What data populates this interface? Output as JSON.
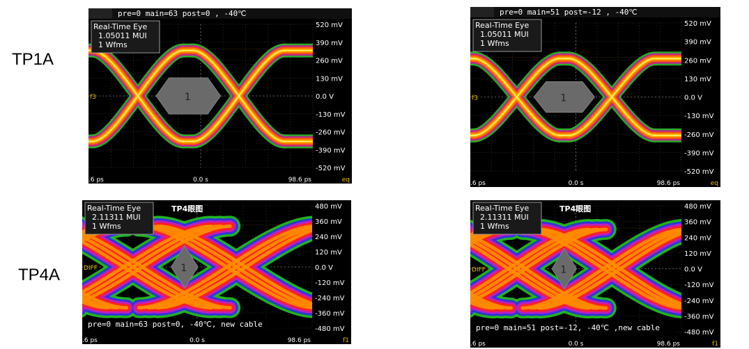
{
  "rows": [
    {
      "label": "TP1A"
    },
    {
      "label": "TP4A"
    }
  ],
  "chart_data": [
    {
      "type": "eye-diagram",
      "row_label": "TP1A",
      "header": "pre=0 main=63 post=0 , -40℃",
      "footer": "",
      "overlay_title": "",
      "info_box": [
        "Real-Time Eye",
        "1.05011 MUI",
        "1 Wfms"
      ],
      "channel_label": "f3",
      "corner_label": "eq",
      "y_ticks": [
        "520 mV",
        "390 mV",
        "260 mV",
        "130 mV",
        "0.0 V",
        "-130 mV",
        "-260 mV",
        "-390 mV",
        "-520 mV"
      ],
      "y_values_mV": [
        520,
        390,
        260,
        130,
        0,
        -130,
        -260,
        -390,
        -520
      ],
      "x_ticks": [
        ".6 ps",
        "0.0 s",
        "98.6 ps"
      ],
      "eye_level_mV": 330,
      "crossings": 1,
      "mask_label": "1",
      "palette": "thermal"
    },
    {
      "type": "eye-diagram",
      "row_label": "TP1A",
      "header": "pre=0 main=51 post=-12  , -40℃",
      "footer": "",
      "overlay_title": "",
      "info_box": [
        "Real-Time Eye",
        "1.05011 MUI",
        "1 Wfms"
      ],
      "channel_label": "f3",
      "corner_label": "eq",
      "y_ticks": [
        "520 mV",
        "390 mV",
        "260 mV",
        "130 mV",
        "0.0 V",
        "-130 mV",
        "-260 mV",
        "-390 mV",
        "-520 mV"
      ],
      "y_values_mV": [
        520,
        390,
        260,
        130,
        0,
        -130,
        -260,
        -390,
        -520
      ],
      "x_ticks": [
        ".6 ps",
        "0.0 s",
        "98.6 ps"
      ],
      "eye_level_mV": 270,
      "crossings": 1,
      "mask_label": "1",
      "palette": "thermal"
    },
    {
      "type": "eye-diagram",
      "row_label": "TP4A",
      "header": "",
      "footer": "pre=0 main=63 post=0, -40℃, new cable",
      "overlay_title": "TP4眼图",
      "info_box": [
        "Real-Time Eye",
        "2.11311 MUI",
        "1 Wfms"
      ],
      "channel_label": "DIFF",
      "corner_label": "f1",
      "y_ticks": [
        "480 mV",
        "360 mV",
        "240 mV",
        "120 mV",
        "0.0 V",
        "-120 mV",
        "-240 mV",
        "-360 mV",
        "-480 mV"
      ],
      "y_values_mV": [
        480,
        360,
        240,
        120,
        0,
        -120,
        -240,
        -360,
        -480
      ],
      "x_ticks": [
        ".6 ps",
        "0.0 s",
        "98.6 ps"
      ],
      "eye_level_mV": 320,
      "crossings": 3,
      "mask_label": "1",
      "palette": "rainbow"
    },
    {
      "type": "eye-diagram",
      "row_label": "TP4A",
      "header": "",
      "footer": "pre=0 main=51 post=-12, -40℃ ,new cable",
      "overlay_title": "TP4眼图",
      "info_box": [
        "Real-Time Eye",
        "2.11311 MUI",
        "1 Wfms"
      ],
      "channel_label": "DIFF",
      "corner_label": "f1",
      "y_ticks": [
        "480 mV",
        "360 mV",
        "240 mV",
        "120 mV",
        "0.0 V",
        "-120 mV",
        "-240 mV",
        "-360 mV",
        "-480 mV"
      ],
      "y_values_mV": [
        480,
        360,
        240,
        120,
        0,
        -120,
        -240,
        -360,
        -480
      ],
      "x_ticks": [
        ".6 ps",
        "0.0 s",
        "98.6 ps"
      ],
      "eye_level_mV": 300,
      "crossings": 3,
      "mask_label": "1",
      "palette": "rainbow"
    }
  ]
}
